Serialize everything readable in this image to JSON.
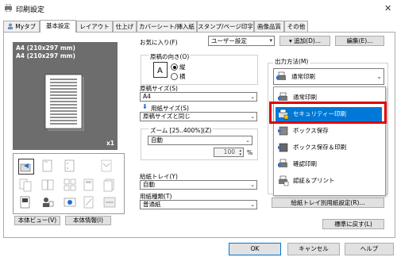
{
  "window": {
    "title": "印刷設定",
    "close_glyph": "✕"
  },
  "tabs": [
    {
      "label": "Myタブ"
    },
    {
      "label": "基本設定"
    },
    {
      "label": "レイアウト"
    },
    {
      "label": "仕上げ"
    },
    {
      "label": "カバーシート/挿入紙"
    },
    {
      "label": "スタンプ/ページ印字"
    },
    {
      "label": "画像品質"
    },
    {
      "label": "その他"
    }
  ],
  "favorites": {
    "label": "お気に入り(F)",
    "value": "ユーザー設定",
    "add_button": "追加(D)...",
    "edit_button": "編集(E)..."
  },
  "preview": {
    "line1": "A4 (210x297 mm)",
    "line2": "A4 (210x297 mm)",
    "copies": "x1"
  },
  "left_buttons": {
    "view": "本体ビュー(V)",
    "info": "本体情報(I)"
  },
  "orientation": {
    "label": "原稿の向き(O)",
    "portrait": "縦",
    "landscape": "横"
  },
  "original_size": {
    "label": "原稿サイズ(S)",
    "value": "A4"
  },
  "paper_size": {
    "label": "用紙サイズ(S)",
    "value": "原稿サイズと同じ"
  },
  "zoom": {
    "label": "ズーム [25..400%](Z)",
    "value": "自動",
    "percent": "100",
    "unit": "%"
  },
  "paper_tray": {
    "label": "給紙トレイ(Y)",
    "value": "自動"
  },
  "paper_type": {
    "label": "用紙種類(T)",
    "value": "普通紙"
  },
  "output_method": {
    "label": "出力方法(M)",
    "value": "通常印刷",
    "options": [
      {
        "label": "通常印刷",
        "icon": "printer-icon"
      },
      {
        "label": "セキュリティー印刷",
        "icon": "lock-printer-icon"
      },
      {
        "label": "ボックス保存",
        "icon": "box-save-icon"
      },
      {
        "label": "ボックス保存＆印刷",
        "icon": "box-save-print-icon"
      },
      {
        "label": "確認印刷",
        "icon": "proof-print-icon"
      },
      {
        "label": "認証＆プリント",
        "icon": "auth-print-icon"
      }
    ],
    "selected_index": 1
  },
  "tray_paper_button": "給紙トレイ別用紙設定(R)...",
  "default_button": "標準に戻す(L)",
  "dialog": {
    "ok": "OK",
    "cancel": "キャンセル",
    "help": "ヘルプ"
  },
  "colors": {
    "selection": "#0078d7",
    "highlight_border": "#e00000",
    "preview_bg": "#6d6d6d"
  }
}
